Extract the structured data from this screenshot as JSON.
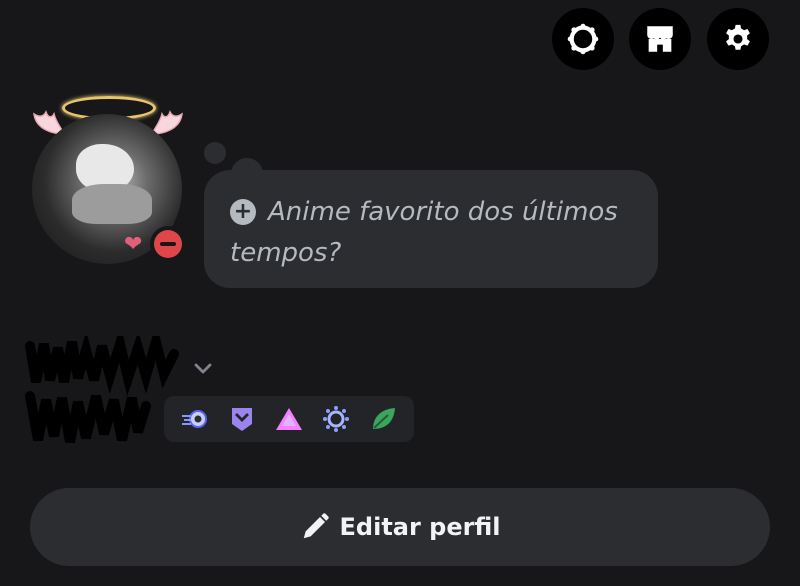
{
  "header": {
    "buttons": [
      {
        "icon": "nitro-icon"
      },
      {
        "icon": "shop-icon"
      },
      {
        "icon": "gear-icon"
      }
    ]
  },
  "profile": {
    "status": "do-not-disturb",
    "status_color": "#e0454a",
    "custom_status_prompt": "Anime favorito dos últimos tempos?",
    "badges": [
      "hypesquad-icon",
      "bravery-chevron-icon",
      "quest-triangle-icon",
      "nitro-laurel-icon",
      "leaf-icon"
    ]
  },
  "actions": {
    "edit_profile_label": "Editar perfil"
  },
  "colors": {
    "background": "#171719",
    "surface": "#2b2d31",
    "badge_bar": "#232428",
    "dnd": "#e0454a"
  }
}
